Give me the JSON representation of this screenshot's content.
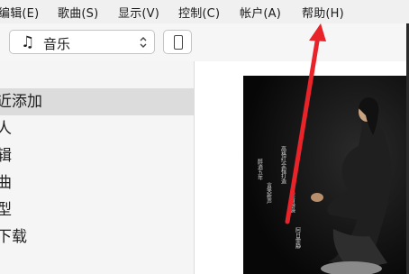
{
  "menubar": {
    "items": [
      {
        "label": "编辑(E)"
      },
      {
        "label": "歌曲(S)"
      },
      {
        "label": "显示(V)"
      },
      {
        "label": "控制(C)"
      },
      {
        "label": "帐户(A)"
      },
      {
        "label": "帮助(H)"
      }
    ]
  },
  "toolbar": {
    "source_selector": {
      "label": "音乐",
      "icon": "music-note-icon"
    },
    "device_button": {
      "icon": "phone-icon"
    }
  },
  "sidebar": {
    "items": [
      {
        "label": "近添加",
        "selected": true
      },
      {
        "label": "人"
      },
      {
        "label": "辑"
      },
      {
        "label": "曲"
      },
      {
        "label": "型"
      },
      {
        "label": "下载"
      }
    ]
  },
  "album": {
    "text_lines": [
      "醉逍五年",
      "言笑新声",
      "高格红全程打造",
      "余音袅袅",
      "阿日雯静"
    ]
  },
  "annotation": {
    "color": "#e8232a"
  }
}
